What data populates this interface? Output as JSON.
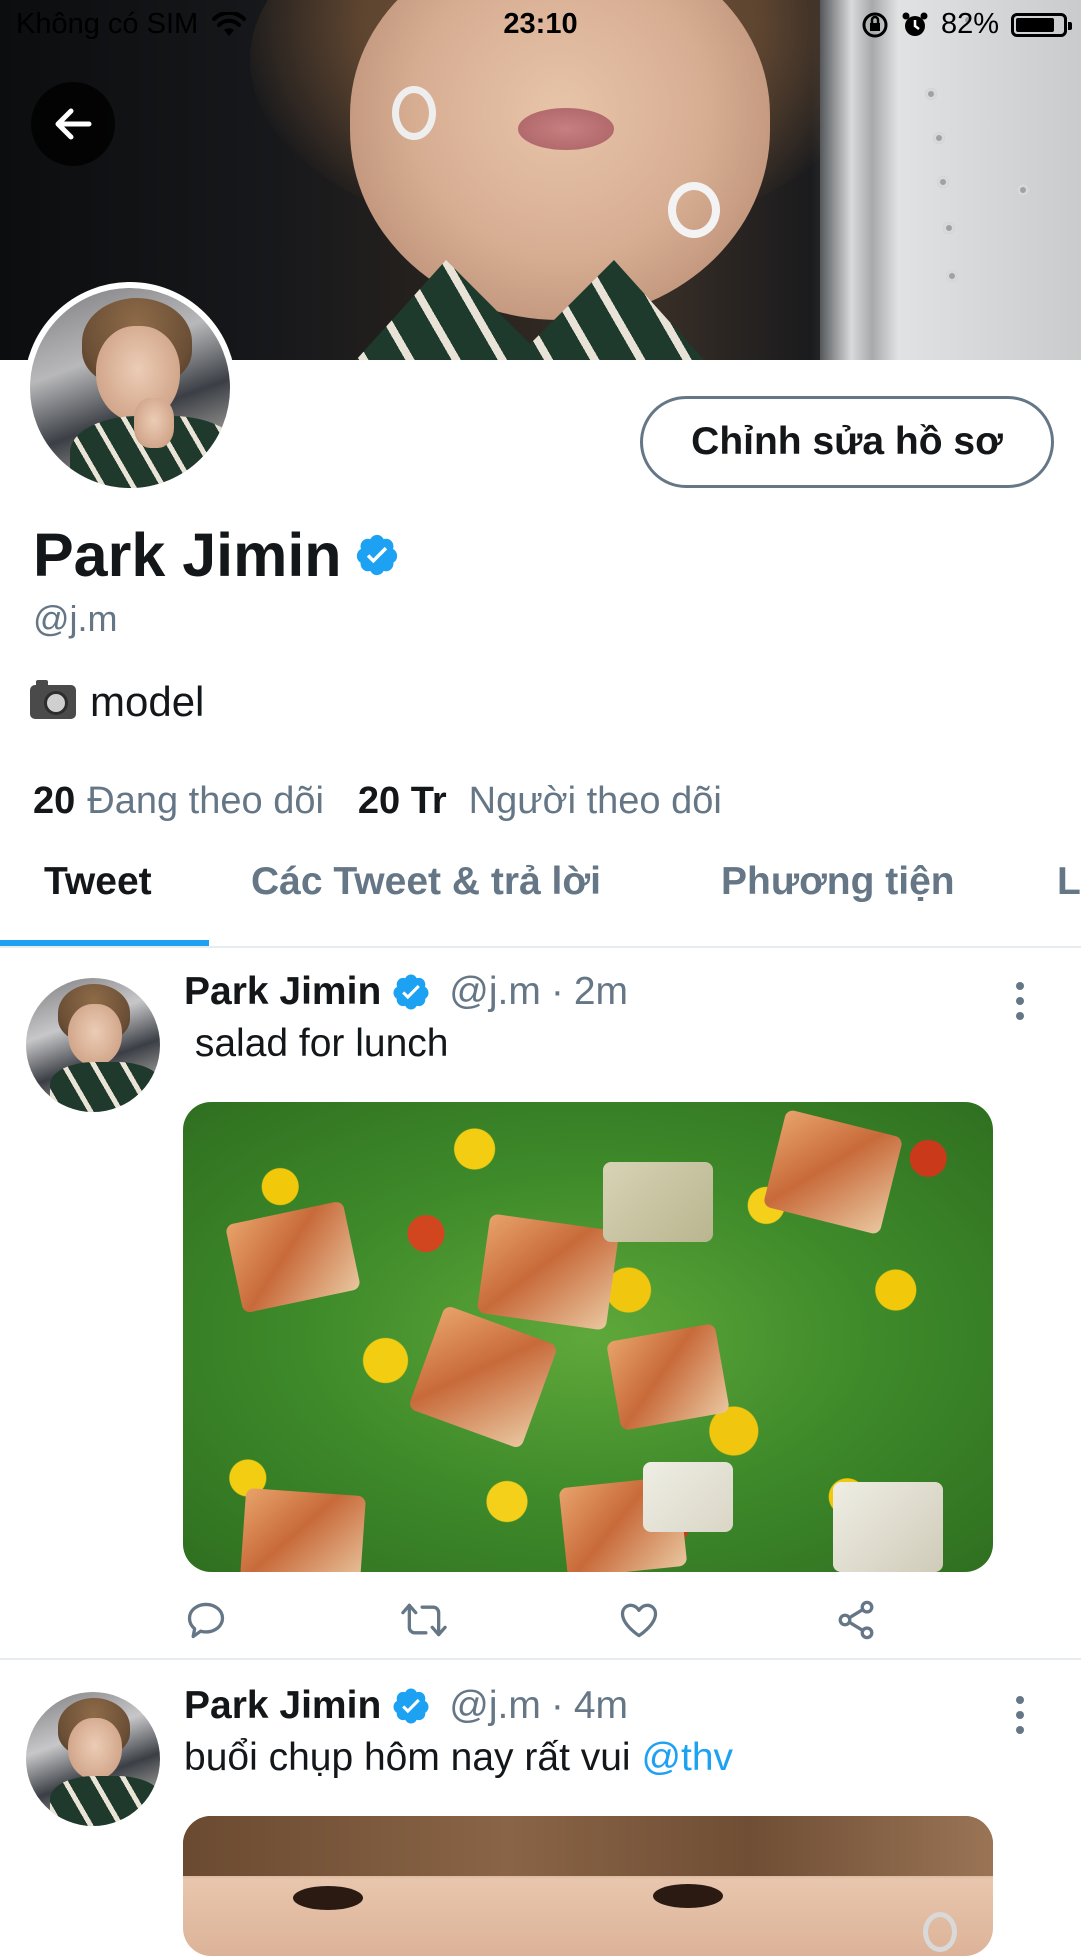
{
  "status_bar": {
    "carrier": "Không có SIM",
    "time": "23:10",
    "battery_percent": "82%",
    "battery_level": 0.82
  },
  "profile": {
    "edit_button": "Chỉnh sửa hồ sơ",
    "name": "Park Jimin",
    "handle": "@j.m",
    "bio": "model",
    "following_count": "20",
    "following_label": "Đang theo dõi",
    "followers_count": "20 Tr",
    "followers_label": "Người theo dõi"
  },
  "tabs": [
    {
      "label": "Tweet",
      "active": true
    },
    {
      "label": "Các Tweet & trả lời",
      "active": false
    },
    {
      "label": "Phương tiện",
      "active": false
    },
    {
      "label": "L",
      "active": false
    }
  ],
  "tweets": [
    {
      "name": "Park Jimin",
      "handle": "@j.m",
      "separator": "·",
      "time": "2m",
      "text": " salad for lunch"
    },
    {
      "name": "Park Jimin",
      "handle": "@j.m",
      "separator": "·",
      "time": "4m",
      "text": "buổi chụp hôm nay rất vui ",
      "mention": "@thv"
    }
  ],
  "colors": {
    "accent": "#1da1f2",
    "secondary_text": "#657786",
    "primary_text": "#14171a"
  },
  "icons": [
    "back-arrow-icon",
    "wifi-icon",
    "orientation-lock-icon",
    "alarm-icon",
    "battery-icon",
    "verified-badge-icon",
    "more-vertical-icon",
    "reply-icon",
    "retweet-icon",
    "like-icon",
    "share-icon",
    "camera-emoji-icon"
  ]
}
